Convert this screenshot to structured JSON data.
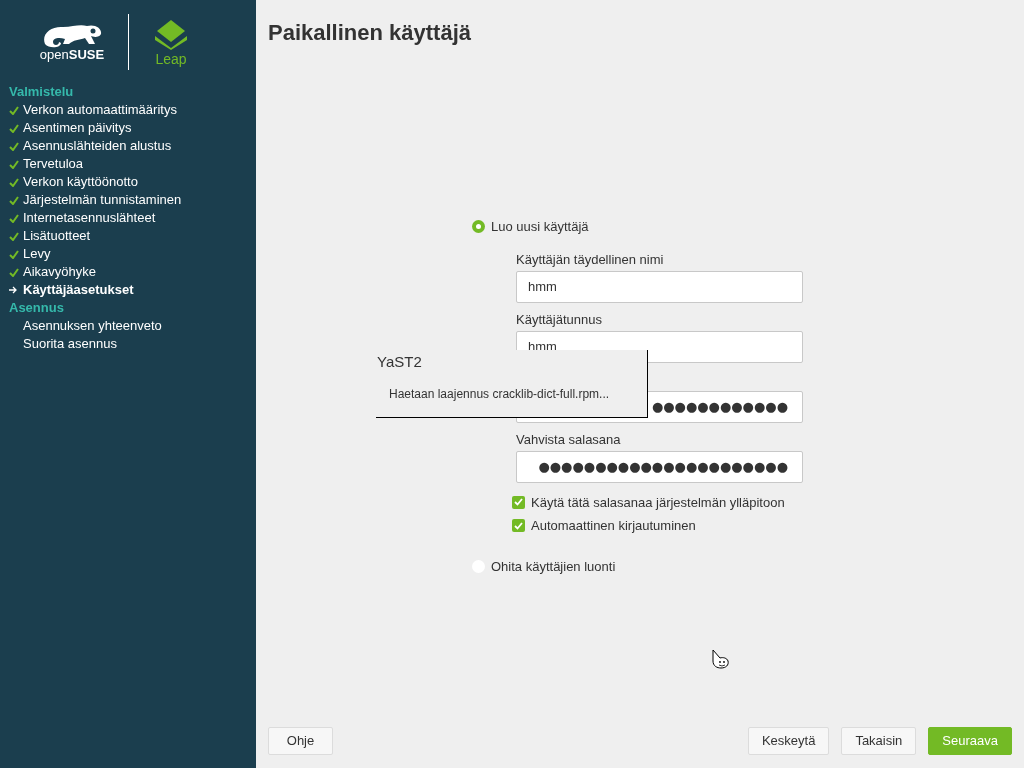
{
  "logo": {
    "brand": "open**SUSE**",
    "product": "Leap"
  },
  "sidebar": {
    "sections": [
      {
        "title": "Valmistelu",
        "items": [
          {
            "label": "Verkon automaattimääritys",
            "kind": "done"
          },
          {
            "label": "Asentimen päivitys",
            "kind": "done"
          },
          {
            "label": "Asennuslähteiden alustus",
            "kind": "done"
          },
          {
            "label": "Tervetuloa",
            "kind": "done"
          },
          {
            "label": "Verkon käyttöönotto",
            "kind": "done"
          },
          {
            "label": "Järjestelmän tunnistaminen",
            "kind": "done"
          },
          {
            "label": "Internetasennuslähteet",
            "kind": "done"
          },
          {
            "label": "Lisätuotteet",
            "kind": "done"
          },
          {
            "label": "Levy",
            "kind": "done"
          },
          {
            "label": "Aikavyöhyke",
            "kind": "done"
          },
          {
            "label": "Käyttäjäasetukset",
            "kind": "current"
          }
        ]
      },
      {
        "title": "Asennus",
        "items": [
          {
            "label": "Asennuksen yhteenveto",
            "kind": "pending"
          },
          {
            "label": "Suorita asennus",
            "kind": "pending"
          }
        ]
      }
    ]
  },
  "title": "Paikallinen käyttäjä",
  "create_option": {
    "label": "Luo uusi käyttäjä",
    "selected": true
  },
  "fields": [
    {
      "label": "Käyttäjän täydellinen nimi",
      "value": "hmm",
      "kind": "text"
    },
    {
      "label": "Käyttäjätunnus",
      "value": "hmm",
      "kind": "text"
    },
    {
      "value": "●●●●●●●●●●●●",
      "kind": "password"
    },
    {
      "label": "Vahvista salasana",
      "value": "●●●●●●●●●●●●●●●●●●●●●●",
      "kind": "password"
    }
  ],
  "checkboxes": [
    {
      "label": "Käytä tätä salasanaa järjestelmän ylläpitoon",
      "checked": true
    },
    {
      "label": "Automaattinen kirjautuminen",
      "checked": true
    }
  ],
  "skip_option": {
    "label": "Ohita käyttäjien luonti",
    "selected": false
  },
  "popup": {
    "title": "YaST2",
    "message": "Haetaan laajennus cracklib-dict-full.rpm..."
  },
  "buttons": {
    "help": "Ohje",
    "right": [
      {
        "label": "Keskeytä",
        "primary": false
      },
      {
        "label": "Takaisin",
        "primary": false
      },
      {
        "label": "Seuraava",
        "primary": true
      }
    ]
  }
}
